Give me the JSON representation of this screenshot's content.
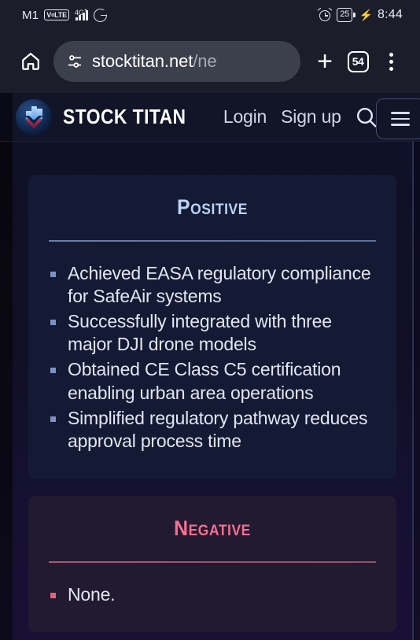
{
  "status_bar": {
    "carrier": "M1",
    "volte_badge": "VoLTE",
    "network_type": "4G",
    "network_sup": "+",
    "app_icon": "google-g-icon",
    "alarm_icon": "alarm-clock-icon",
    "battery_level": "25",
    "charging_icon": "charging-bolt-icon",
    "time": "8:44"
  },
  "browser": {
    "home_icon": "home-icon",
    "site_settings_icon": "tune-settings-icon",
    "url_host": "stocktitan.net",
    "url_path": "/ne",
    "new_tab_icon": "plus-icon",
    "tab_count": "54",
    "menu_icon": "kebab-menu-icon"
  },
  "site_header": {
    "logo_icon": "stock-titan-logo-icon",
    "brand": "STOCK TITAN",
    "login_label": "Login",
    "signup_label": "Sign up",
    "search_icon": "search-icon",
    "hamburger_icon": "hamburger-menu-icon"
  },
  "sections": [
    {
      "title": "Positive",
      "accent": "#b9d4f7",
      "items": [
        "Achieved EASA regulatory compliance for SafeAir systems",
        "Successfully integrated with three major DJI drone models",
        "Obtained CE Class C5 certification enabling urban area operations",
        "Simplified regulatory pathway reduces approval process time"
      ]
    },
    {
      "title": "Negative",
      "accent": "#f7708f",
      "items": [
        "None."
      ]
    }
  ]
}
